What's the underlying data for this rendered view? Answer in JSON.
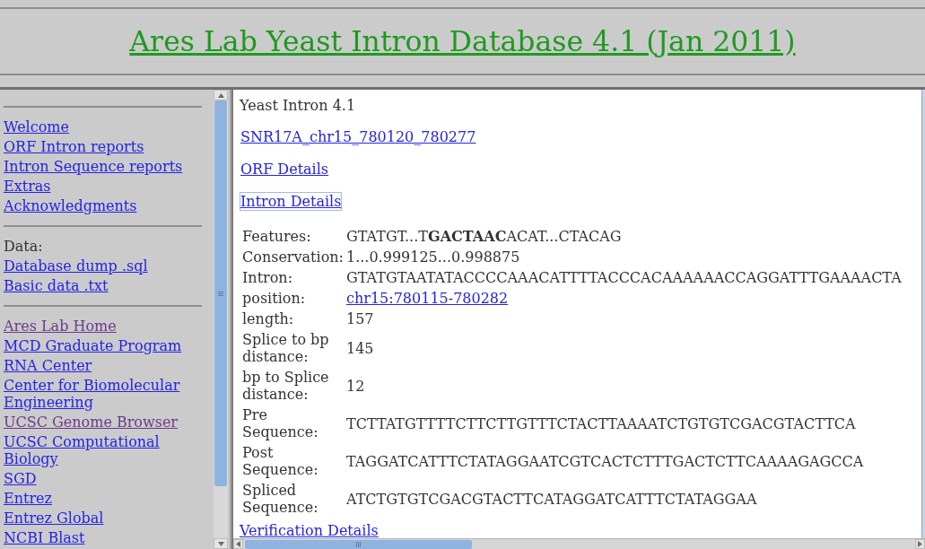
{
  "header": {
    "title": "Ares Lab Yeast Intron Database 4.1 (Jan 2011)"
  },
  "sidebar": {
    "sections": [
      {
        "items": [
          {
            "kind": "link",
            "label": "Welcome",
            "visited": false
          },
          {
            "kind": "link",
            "label": "ORF Intron reports",
            "visited": false
          },
          {
            "kind": "link",
            "label": "Intron Sequence reports",
            "visited": false
          },
          {
            "kind": "link",
            "label": "Extras",
            "visited": false
          },
          {
            "kind": "link",
            "label": "Acknowledgments",
            "visited": false
          }
        ]
      },
      {
        "items": [
          {
            "kind": "heading",
            "label": "Data:"
          },
          {
            "kind": "link",
            "label": "Database dump .sql",
            "visited": false
          },
          {
            "kind": "link",
            "label": "Basic data .txt",
            "visited": false
          }
        ]
      },
      {
        "items": [
          {
            "kind": "link",
            "label": "Ares Lab Home",
            "visited": true
          },
          {
            "kind": "link",
            "label": "MCD Graduate Program",
            "visited": false
          },
          {
            "kind": "link",
            "label": "RNA Center",
            "visited": false
          },
          {
            "kind": "link",
            "label": "Center for Biomolecular Engineering",
            "visited": false
          },
          {
            "kind": "link",
            "label": "UCSC Genome Browser",
            "visited": true
          },
          {
            "kind": "link",
            "label": "UCSC Computational Biology",
            "visited": false
          },
          {
            "kind": "link",
            "label": "SGD",
            "visited": false
          },
          {
            "kind": "link",
            "label": "Entrez",
            "visited": false
          },
          {
            "kind": "link",
            "label": "Entrez Global",
            "visited": false
          },
          {
            "kind": "link",
            "label": "NCBI Blast",
            "visited": false
          }
        ]
      }
    ]
  },
  "main": {
    "heading": "Yeast Intron 4.1",
    "links": [
      {
        "label": "SNR17A_chr15_780120_780277",
        "focused": false
      },
      {
        "label": "ORF Details",
        "focused": false
      },
      {
        "label": "Intron Details",
        "focused": true
      }
    ],
    "details": [
      {
        "label": "Features:",
        "kind": "text",
        "value": "GTATGT...T**GACTAAC**ACAT...CTACAG"
      },
      {
        "label": "Conservation:",
        "kind": "text",
        "value": "1...0.999125...0.998875"
      },
      {
        "label": "Intron:",
        "kind": "text",
        "value": "GTATGTAATATACCCCAAACATTTTACCCACAAAAAACCAGGATTTGAAAACTA"
      },
      {
        "label": "position:",
        "kind": "link",
        "value": "chr15:780115-780282"
      },
      {
        "label": "length:",
        "kind": "text",
        "value": "157"
      },
      {
        "label": "Splice to bp distance:",
        "kind": "text",
        "value": "145"
      },
      {
        "label": "bp to Splice distance:",
        "kind": "text",
        "value": "12"
      },
      {
        "label": "Pre Sequence:",
        "kind": "text",
        "value": "TCTTATGTTTTCTTCTTGTTTCTACTTAAAATCTGTGTCGACGTACTTCA"
      },
      {
        "label": "Post Sequence:",
        "kind": "text",
        "value": "TAGGATCATTTCTATAGGAATCGTCACTCTTTGACTCTTCAAAAGAGCCA"
      },
      {
        "label": "Spliced Sequence:",
        "kind": "text",
        "value": "ATCTGTGTCGACGTACTTCATAGGATCATTTCTATAGGAA"
      }
    ],
    "footer_link": {
      "label": "Verification Details"
    }
  }
}
